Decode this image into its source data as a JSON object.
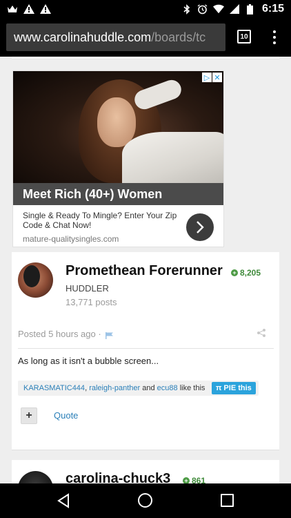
{
  "status_bar": {
    "time": "6:15",
    "left_icons": [
      "crown-icon",
      "warning-icon",
      "warning-icon"
    ],
    "right_icons": [
      "bluetooth-icon",
      "alarm-icon",
      "wifi-icon",
      "signal-icon",
      "battery-icon"
    ]
  },
  "browser": {
    "url_host": "www.carolinahuddle.com",
    "url_path": "/boards/tc",
    "tab_count": "10"
  },
  "ad": {
    "title": "Meet Rich (40+) Women",
    "text": "Single & Ready To Mingle? Enter Your Zip Code & Chat Now!",
    "domain": "mature-qualitysingles.com",
    "choices": [
      "▷",
      "✕"
    ]
  },
  "post": {
    "username": "Promethean Forerunner",
    "reputation": "8,205",
    "rank": "HUDDLER",
    "post_count": "13,771 posts",
    "posted": "Posted 5 hours ago ·",
    "body": "As long as it isn't a bubble screen...",
    "likers": [
      "KARASMATIC444",
      "raleigh-panther",
      "ecu88"
    ],
    "likes_sep": ",",
    "likes_and": "and",
    "likes_suffix": "like this",
    "pie_label": "PIE this",
    "pie_symbol": "π",
    "plus_label": "+",
    "quote_label": "Quote"
  },
  "post2": {
    "username": "carolina-chuck3",
    "reputation": "861"
  },
  "colors": {
    "link": "#2a7fb8",
    "reputation": "#3f8a3a",
    "pie_button": "#2ba3dc"
  }
}
